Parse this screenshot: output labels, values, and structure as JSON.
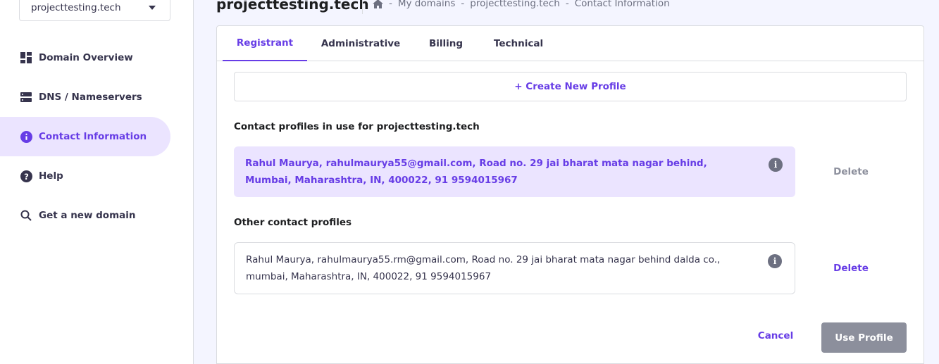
{
  "sidebar": {
    "domain_select": "projecttesting.tech",
    "items": [
      {
        "label": "Domain Overview",
        "icon": "dashboard-icon"
      },
      {
        "label": "DNS / Nameservers",
        "icon": "server-icon"
      },
      {
        "label": "Contact Information",
        "icon": "info-icon",
        "active": true
      },
      {
        "label": "Help",
        "icon": "help-icon"
      },
      {
        "label": "Get a new domain",
        "icon": "search-icon"
      }
    ]
  },
  "header": {
    "title": "projecttesting.tech",
    "breadcrumb": [
      "My domains",
      "projecttesting.tech",
      "Contact Information"
    ]
  },
  "tabs": [
    "Registrant",
    "Administrative",
    "Billing",
    "Technical"
  ],
  "create_profile_label": "+ Create New Profile",
  "in_use_label": "Contact profiles in use for projecttesting.tech",
  "in_use_profile": "Rahul Maurya, rahulmaurya55@gmail.com, Road no. 29 jai bharat mata nagar behind, Mumbai, Maharashtra, IN, 400022, 91 9594015967",
  "other_label": "Other contact profiles",
  "other_profile": "Rahul Maurya, rahulmaurya55.rm@gmail.com, Road no. 29 jai bharat mata nagar behind dalda co., mumbai, Maharashtra, IN, 400022, 91 9594015967",
  "delete_label": "Delete",
  "cancel_label": "Cancel",
  "use_profile_label": "Use Profile",
  "colors": {
    "accent": "#673de6",
    "accent_light": "#ebe4ff",
    "disabled_button": "#8c8f9c"
  }
}
